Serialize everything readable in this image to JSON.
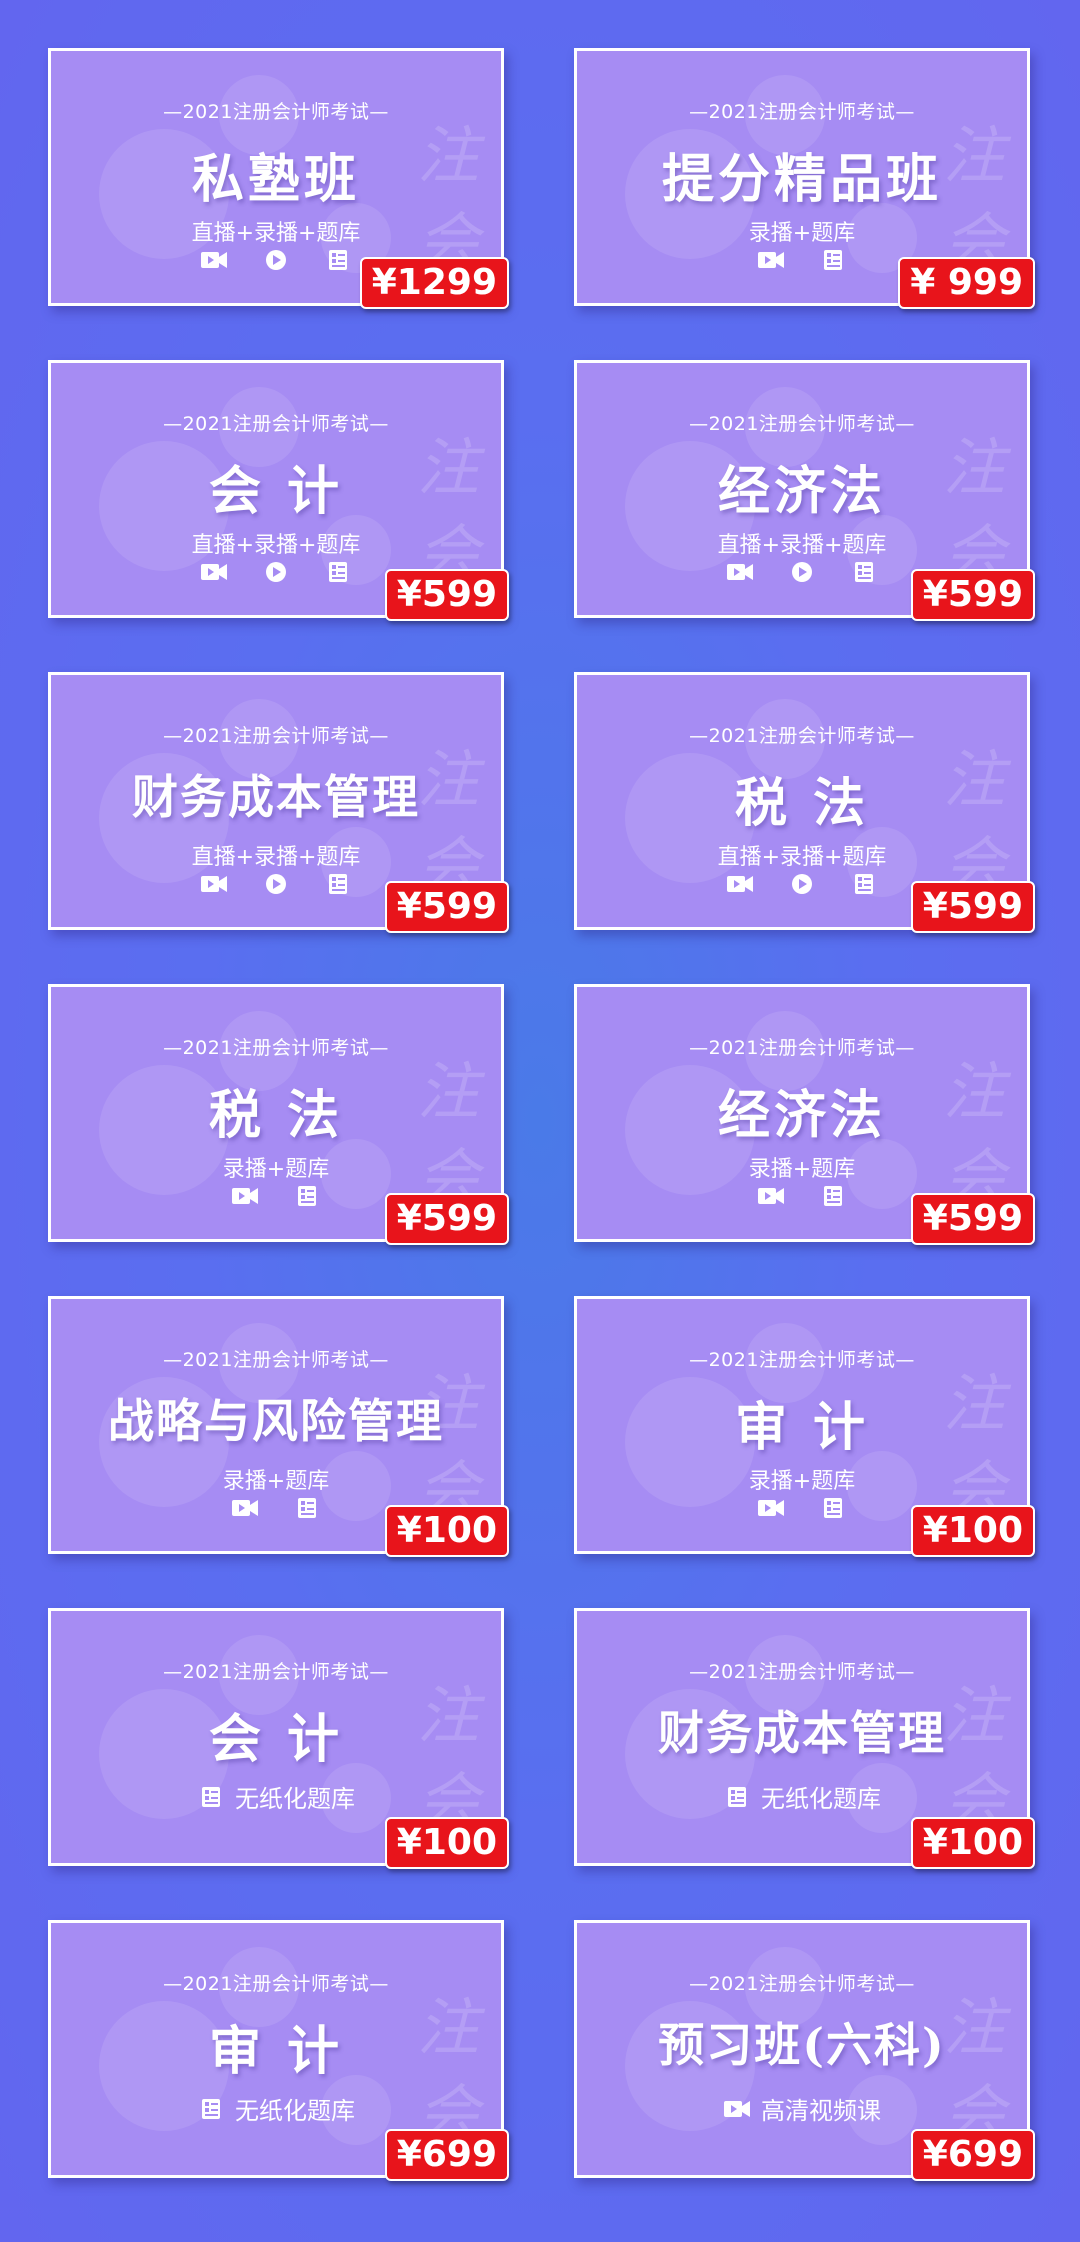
{
  "exam_label": "—2021注册会计师考试—",
  "watermark": "注会",
  "cards": [
    {
      "title": "私塾班",
      "sub": "直播+录播+题库",
      "price": "¥1299"
    },
    {
      "title": "提分精品班",
      "sub": "录播+题库",
      "price": "¥ 999"
    },
    {
      "title": "会 计",
      "sub": "直播+录播+题库",
      "price": "¥599"
    },
    {
      "title": "经济法",
      "sub": "直播+录播+题库",
      "price": "¥599"
    },
    {
      "title": "财务成本管理",
      "sub": "直播+录播+题库",
      "price": "¥599"
    },
    {
      "title": "税 法",
      "sub": "直播+录播+题库",
      "price": "¥599"
    },
    {
      "title": "税 法",
      "sub": "录播+题库",
      "price": "¥599"
    },
    {
      "title": "经济法",
      "sub": "录播+题库",
      "price": "¥599"
    },
    {
      "title": "战略与风险管理",
      "sub": "录播+题库",
      "price": "¥100"
    },
    {
      "title": "审 计",
      "sub": "录播+题库",
      "price": "¥100"
    },
    {
      "title": "会 计",
      "sub": "无纸化题库",
      "price": "¥100"
    },
    {
      "title": "财务成本管理",
      "sub": "无纸化题库",
      "price": "¥100"
    },
    {
      "title": "审 计",
      "sub": "无纸化题库",
      "price": "¥699"
    },
    {
      "title": "预习班(六科)",
      "sub": "高清视频课",
      "price": "¥699"
    }
  ],
  "icon_names": {
    "video": "video-camera-icon",
    "play": "play-circle-icon",
    "quiz": "question-bank-icon"
  },
  "colors": {
    "card_bg": "#a68cf3",
    "price_bg": "#e8141b",
    "page_bg": "#5a6ef0"
  }
}
